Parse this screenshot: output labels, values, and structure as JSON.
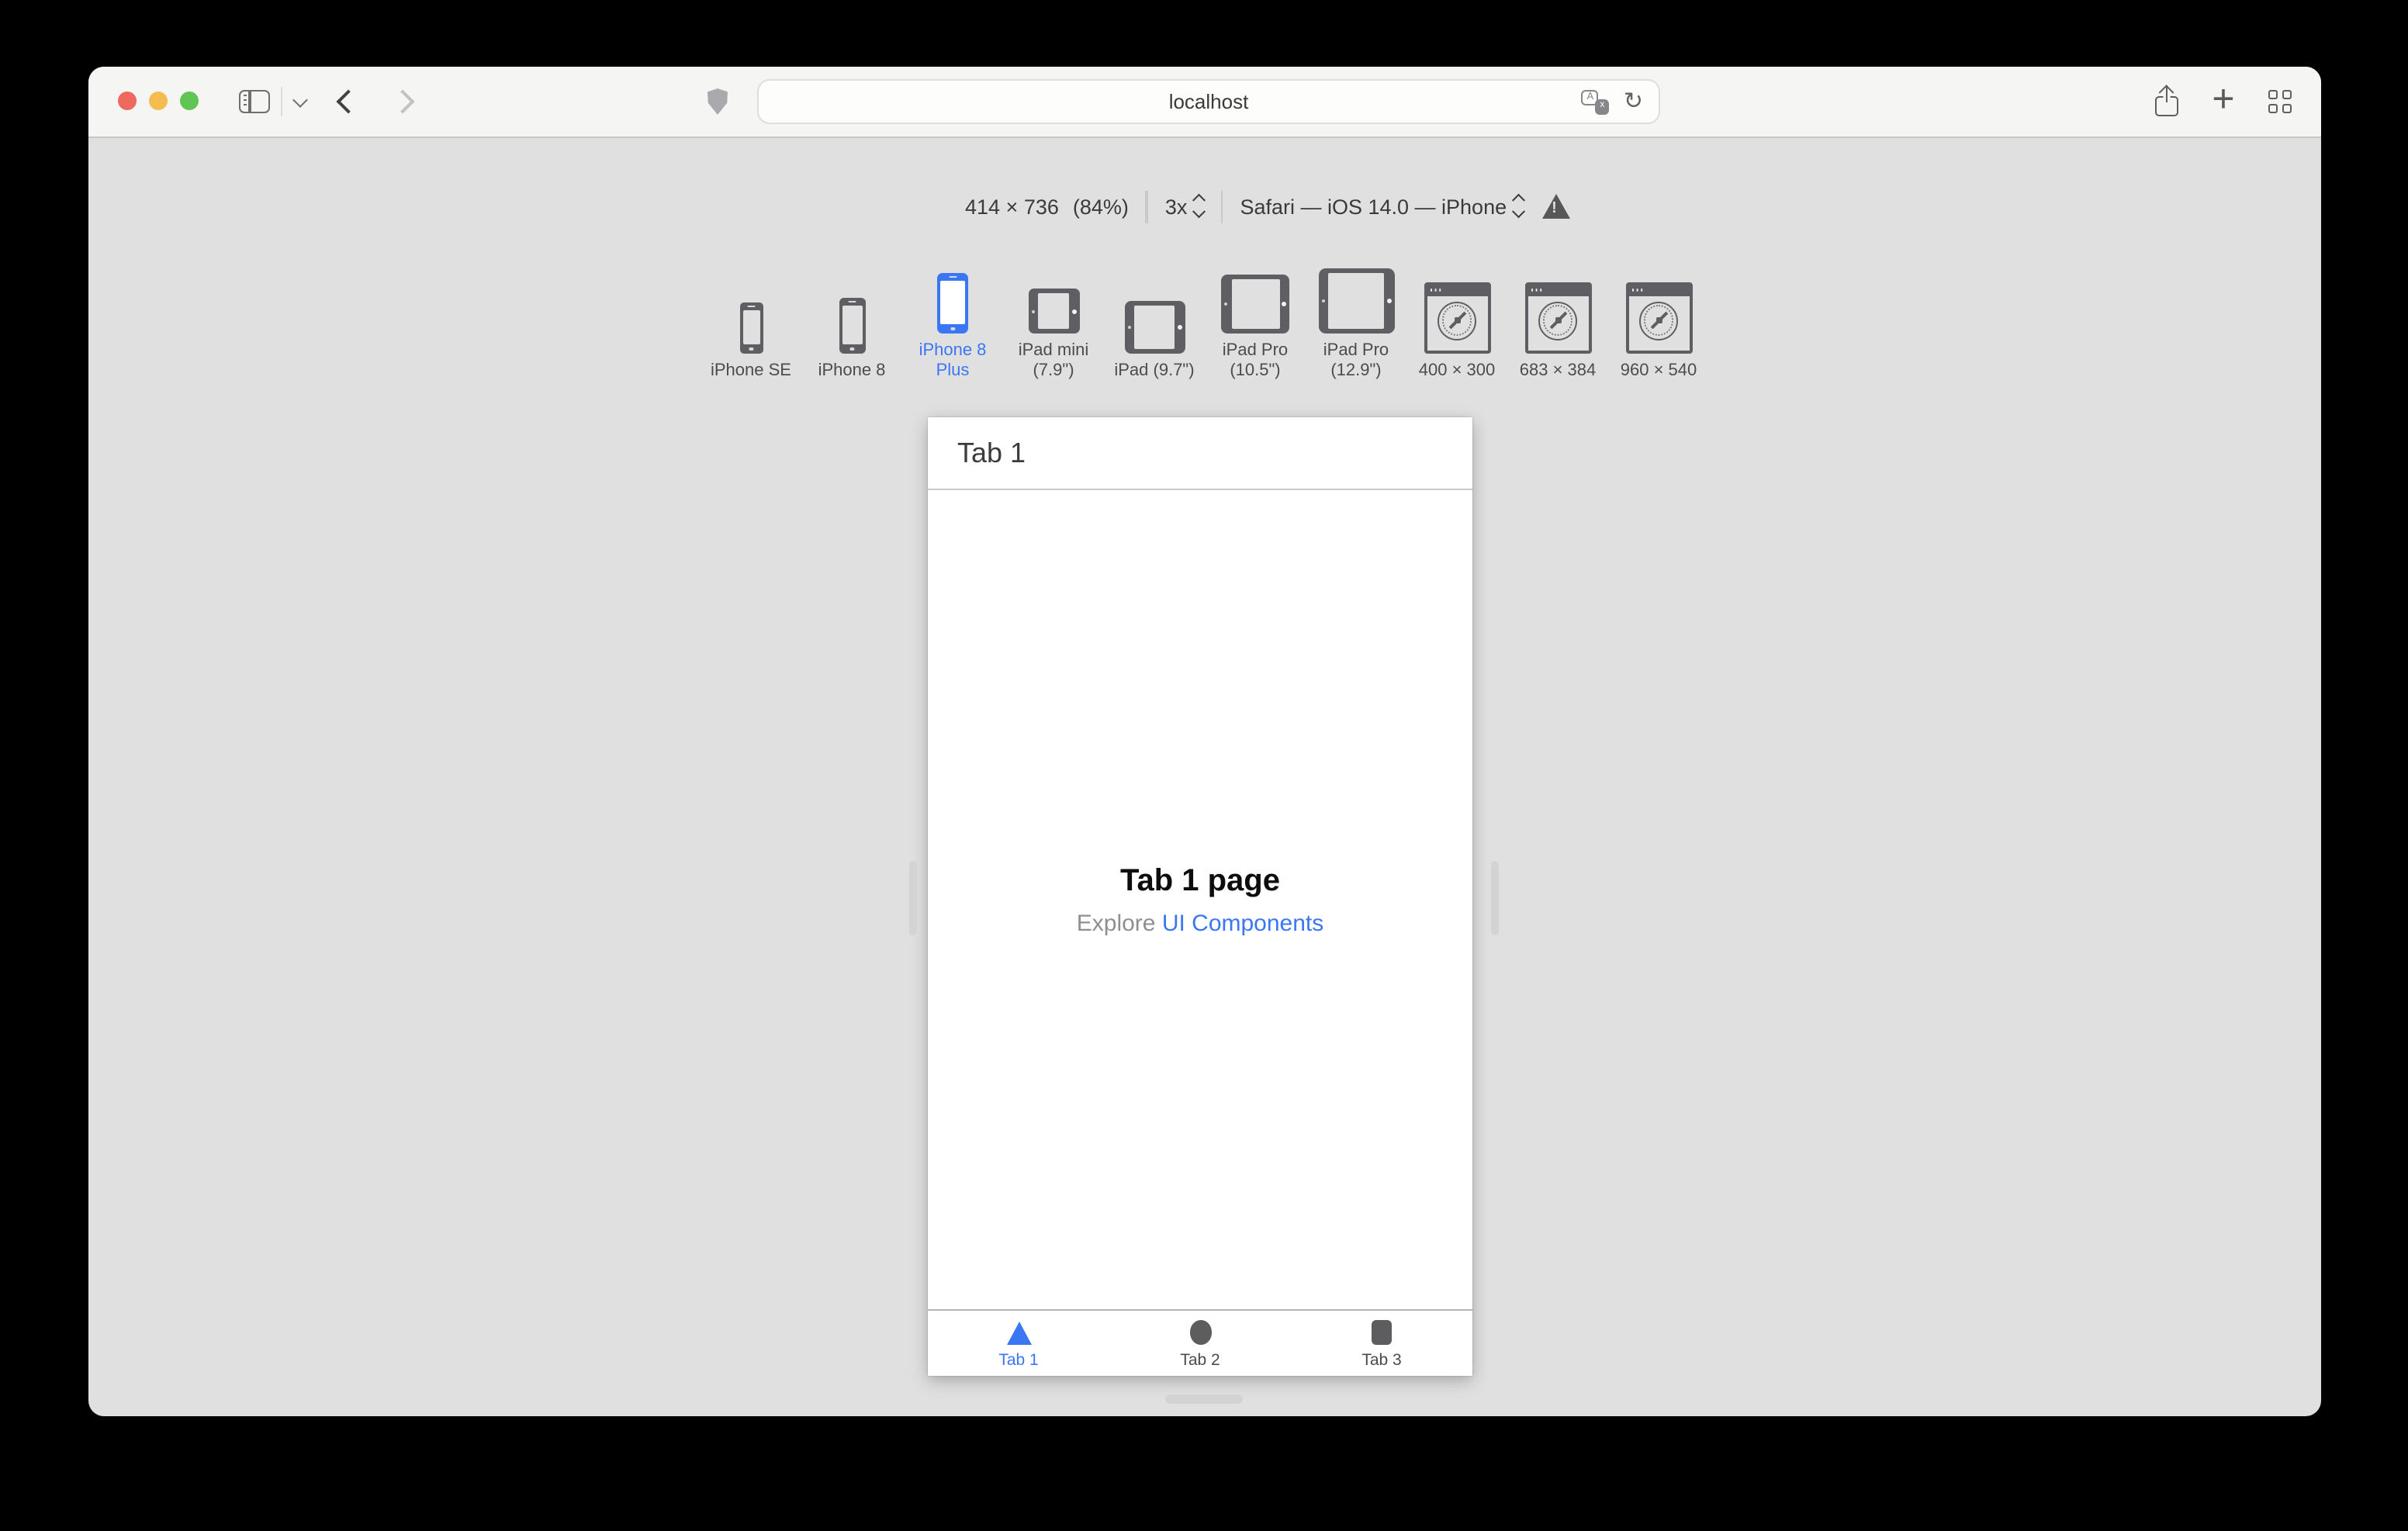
{
  "browser": {
    "url": "localhost",
    "icons": {
      "plus_glyph": "+",
      "reload_glyph": "↻",
      "translate_a": "A",
      "translate_x": "x"
    }
  },
  "rdm_toolbar": {
    "viewport_size": "414 × 736",
    "zoom_percent": "(84%)",
    "device_pixel_ratio": "3x",
    "user_agent": "Safari — iOS 14.0 — iPhone"
  },
  "device_presets": [
    {
      "label": "iPhone SE",
      "variant": "se",
      "kind": "iphone-portrait-icon",
      "selected": false
    },
    {
      "label": "iPhone 8",
      "variant": "i8",
      "kind": "iphone-portrait-icon",
      "selected": false
    },
    {
      "label": "iPhone 8 Plus",
      "variant": "i8p",
      "kind": "iphone-portrait-icon",
      "selected": true
    },
    {
      "label": "iPad mini (7.9\")",
      "variant": "ipadmini",
      "kind": "ipad-landscape-icon",
      "selected": false
    },
    {
      "label": "iPad (9.7\")",
      "variant": "ipad",
      "kind": "ipad-landscape-icon",
      "selected": false
    },
    {
      "label": "iPad Pro (10.5\")",
      "variant": "ipadpro105",
      "kind": "ipad-landscape-icon",
      "selected": false
    },
    {
      "label": "iPad Pro (12.9\")",
      "variant": "ipadpro129",
      "kind": "ipad-landscape-icon",
      "selected": false
    },
    {
      "label": "400 × 300",
      "variant": "win",
      "kind": "browser-window-icon",
      "selected": false
    },
    {
      "label": "683 × 384",
      "variant": "win",
      "kind": "browser-window-icon",
      "selected": false
    },
    {
      "label": "960 × 540",
      "variant": "win",
      "kind": "browser-window-icon",
      "selected": false
    }
  ],
  "app_preview": {
    "header_title": "Tab 1",
    "content_title": "Tab 1 page",
    "content_subtitle_prefix": "Explore ",
    "content_subtitle_link": "UI Components",
    "tab_bar": [
      {
        "label": "Tab 1",
        "shape": "triangle",
        "active": true
      },
      {
        "label": "Tab 2",
        "shape": "circle",
        "active": false
      },
      {
        "label": "Tab 3",
        "shape": "square",
        "active": false
      }
    ]
  },
  "colors": {
    "accent_blue": "#3b76f5",
    "device_icon_gray": "#5f5f63",
    "window_bg": "#e0e0e0",
    "toolbar_bg": "#f5f5f4"
  }
}
